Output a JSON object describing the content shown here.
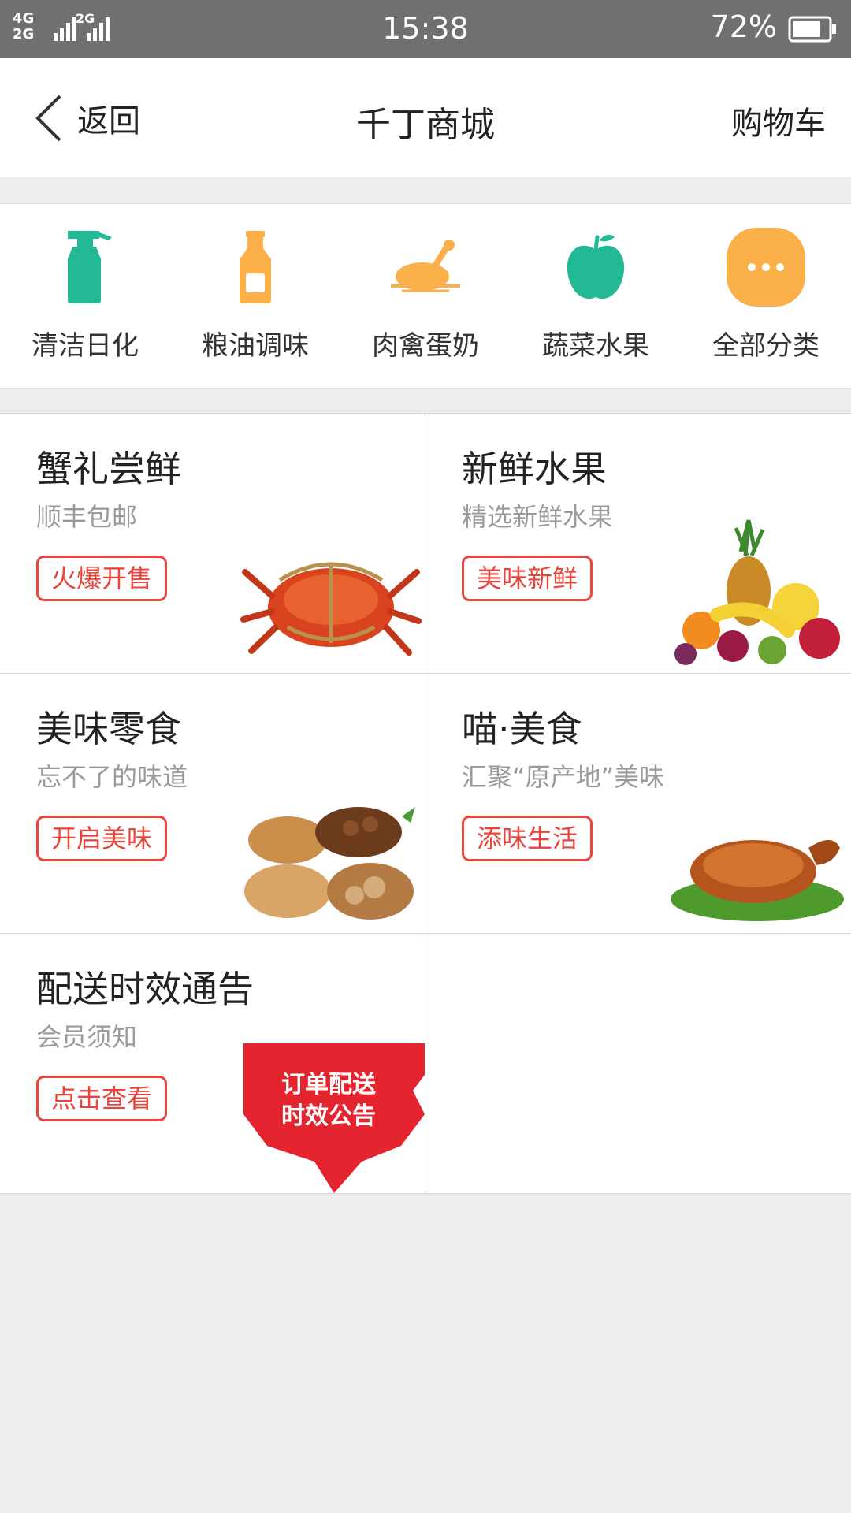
{
  "status_bar": {
    "network_top": "4G",
    "network_bottom": "2G",
    "network_2": "2G",
    "time": "15:38",
    "battery": "72%"
  },
  "nav": {
    "back_label": "返回",
    "title": "千丁商城",
    "cart_label": "购物车"
  },
  "categories": [
    {
      "label": "清洁日化",
      "icon": "spray-bottle-icon",
      "color": "#23b996"
    },
    {
      "label": "粮油调味",
      "icon": "sauce-bottle-icon",
      "color": "#fbb04a"
    },
    {
      "label": "肉禽蛋奶",
      "icon": "roast-chicken-icon",
      "color": "#fbb04a"
    },
    {
      "label": "蔬菜水果",
      "icon": "apple-icon",
      "color": "#23b996"
    },
    {
      "label": "全部分类",
      "icon": "more-icon",
      "color": "#fbb04a"
    }
  ],
  "products": [
    {
      "title": "蟹礼尝鲜",
      "subtitle": "顺丰包邮",
      "tag": "火爆开售",
      "image": "crab-image"
    },
    {
      "title": "新鲜水果",
      "subtitle": "精选新鲜水果",
      "tag": "美味新鲜",
      "image": "fruit-image"
    },
    {
      "title": "美味零食",
      "subtitle": "忘不了的味道",
      "tag": "开启美味",
      "image": "nuts-image"
    },
    {
      "title": "喵·美食",
      "subtitle": "汇聚“原产地”美味",
      "tag": "添味生活",
      "image": "roast-duck-image"
    },
    {
      "title": "配送时效通告",
      "subtitle": "会员须知",
      "tag": "点击查看",
      "image": "notice-banner-image",
      "banner_text": [
        "订单配送",
        "时效公告"
      ]
    }
  ],
  "colors": {
    "accent_red": "#e8453c",
    "green": "#23b996",
    "orange": "#fbb04a"
  }
}
